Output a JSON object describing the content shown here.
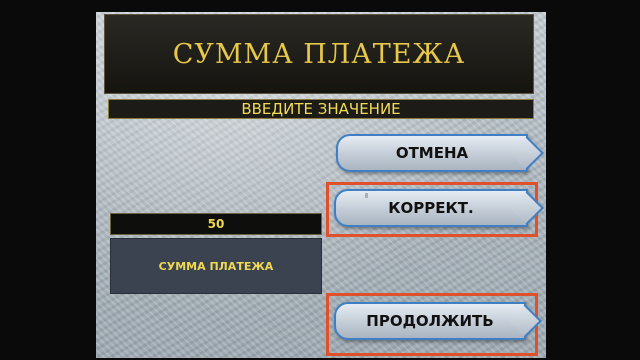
{
  "header": {
    "title": "СУММА ПЛАТЕЖА",
    "subtitle": "ВВЕДИТЕ ЗНАЧЕНИЕ"
  },
  "buttons": {
    "cancel_label": "ОТМЕНА",
    "correct_label": "КОРРЕКТ.",
    "continue_label": "ПРОДОЛЖИТЬ"
  },
  "amount": {
    "value": "50",
    "label": "СУММА ПЛАТЕЖА"
  },
  "colors": {
    "title_text": "#e8c84a",
    "value_text": "#f0d850",
    "button_border": "#3f7fc4",
    "highlight": "#e0502a"
  }
}
